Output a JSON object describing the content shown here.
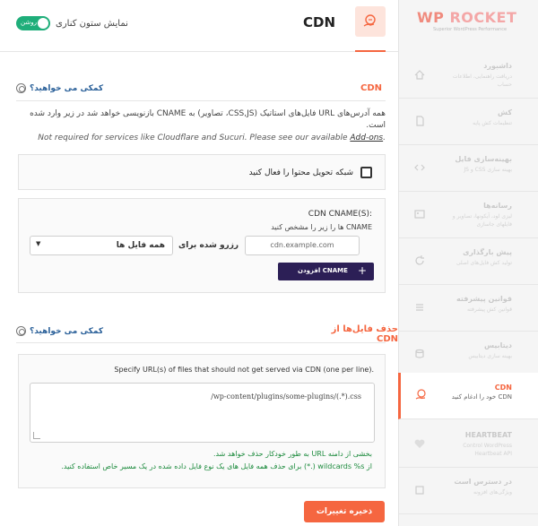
{
  "brand": {
    "logo_wp": "WP",
    "logo_rocket": "ROCKET",
    "tagline": "Superior WordPress Performance",
    "accent": "#f56640",
    "dark": "#2c1f56",
    "green": "#1fae7a"
  },
  "sidebar": {
    "items": [
      {
        "title": "داشبورد",
        "desc": "دریافت راهنمایی، اطلاعات حساب",
        "icon": "home-icon"
      },
      {
        "title": "کش",
        "desc": "تنظیمات کش پایه",
        "icon": "file-icon"
      },
      {
        "title": "بهینه‌سازی فایل",
        "desc": "بهینه سازی CSS و JS",
        "icon": "code-icon"
      },
      {
        "title": "رسانه‌ها",
        "desc": "لیزی لود، آیکونها، تصاویر و فایلهای جاسازی",
        "icon": "media-icon"
      },
      {
        "title": "پیش بارگذاری",
        "desc": "تولید کش فایل‌های اصلی",
        "icon": "refresh-icon"
      },
      {
        "title": "قوانین پیشرفته",
        "desc": "قوانین کش پیشرفته",
        "icon": "list-icon"
      },
      {
        "title": "دیتابیس",
        "desc": "بهینه سازی دیتابیس",
        "icon": "database-icon"
      },
      {
        "title": "CDN",
        "desc": "CDN خود را ادغام کنید",
        "icon": "cdn-icon"
      },
      {
        "title": "HEARTBEAT",
        "desc": "Control WordPress Heartbeat API",
        "icon": "heart-icon"
      },
      {
        "title": "در دسترس است",
        "desc": "ویژگی‌های افزونه",
        "icon": "addon-icon"
      }
    ]
  },
  "header": {
    "title": "CDN",
    "toggle_state": "روشن",
    "toggle_label": "نمایش ستون کناری"
  },
  "cdn_section": {
    "title": "CDN",
    "help": "کمکی می خواهید؟",
    "description": "همه آدرس‌های URL فایل‌های استاتیک (CSS,JS، تصاویر) به CNAME بازنویسی خواهد شد در زیر وارد شده است.",
    "note_prefix": "Not required for services like Cloudflare and Sucuri. Please see our available ",
    "note_link": "Add-ons",
    "note_suffix": ".",
    "enable_label": "شبکه تحویل محتوا را فعال کنید",
    "cname_title": "CDN CNAME(S):",
    "cname_subtitle": "CNAME ها را زیر را مشخص کنید",
    "cname_placeholder": "cdn.example.com",
    "reserved_for": "رزرو شده برای",
    "select_value": "همه فایل ها",
    "add_button": "افزودن CNAME"
  },
  "exclude_section": {
    "title": "حذف فایل‌ها از CDN",
    "help": "کمکی می خواهید؟",
    "description": "Specify URL(s) of files that should not get served via CDN (one per line).",
    "textarea_value": "/wp-content/plugins/some-plugins/(.*).css",
    "hint1": "بخشی از دامنه URL به طور خودکار حذف خواهد شد.",
    "hint2": "از wildcards %s (.*) برای حذف همه فایل های یک نوع فایل داده شده در یک مسیر خاص استفاده کنید."
  },
  "save_button": "ذخیره تغییرات"
}
